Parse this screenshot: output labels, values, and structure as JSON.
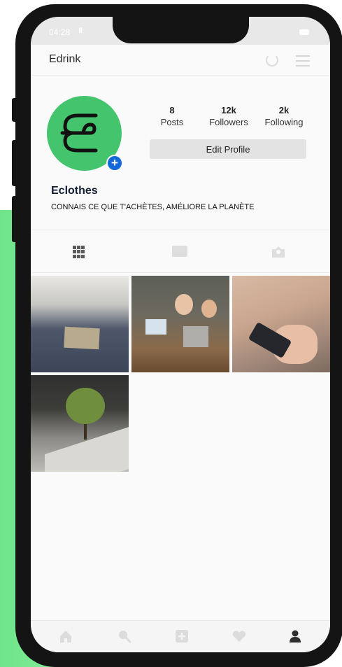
{
  "status_bar": {
    "time": "04:28",
    "signal": "Ill"
  },
  "app_bar": {
    "title": "Edrink"
  },
  "profile": {
    "name": "Eclothes",
    "bio": "CONNAIS CE QUE T'ACHÈTES, AMÉLIORE LA PLANÈTE",
    "stats": [
      {
        "value": "8",
        "label": "Posts"
      },
      {
        "value": "12k",
        "label": "Followers"
      },
      {
        "value": "2k",
        "label": "Following"
      }
    ],
    "edit_button_label": "Edit Profile",
    "avatar_color": "#44c46d",
    "add_badge_color": "#1468d8"
  },
  "tabs": [
    {
      "icon": "grid-icon",
      "active": true
    },
    {
      "icon": "tv-icon",
      "active": false
    },
    {
      "icon": "tagged-icon",
      "active": false
    }
  ],
  "posts": [
    {
      "subject": "folded-denim-with-tag"
    },
    {
      "subject": "two-people-with-laptops"
    },
    {
      "subject": "hands-holding-phone"
    },
    {
      "subject": "tree-and-staircase"
    }
  ],
  "bottom_nav": [
    {
      "icon": "home-icon"
    },
    {
      "icon": "search-icon"
    },
    {
      "icon": "add-post-icon"
    },
    {
      "icon": "heart-icon"
    },
    {
      "icon": "profile-icon",
      "active": true
    }
  ],
  "colors": {
    "accent_green": "#6fe58a",
    "phone_frame": "#141414"
  }
}
